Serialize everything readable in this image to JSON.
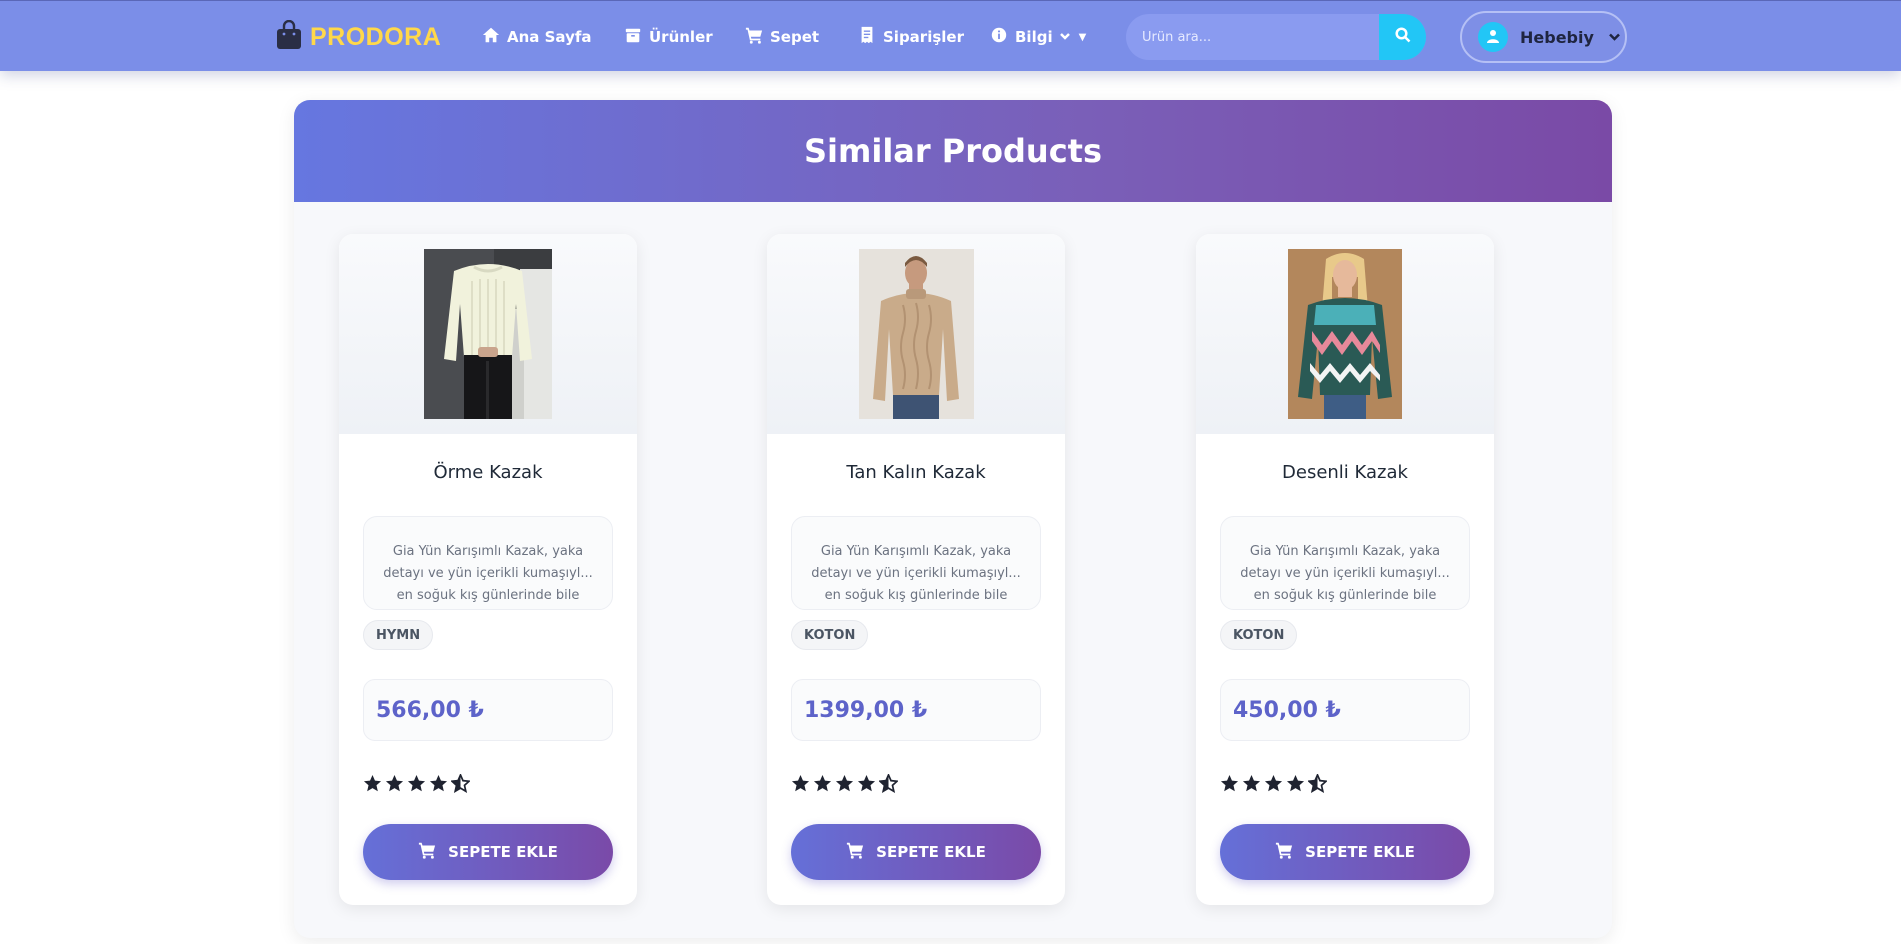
{
  "nav": {
    "brand": "PRODORA",
    "items": [
      {
        "label": "Ana Sayfa",
        "icon": "home-icon"
      },
      {
        "label": "Ürünler",
        "icon": "box-icon"
      },
      {
        "label": "Sepet",
        "icon": "cart-icon"
      },
      {
        "label": "Siparişler",
        "icon": "receipt-icon"
      },
      {
        "label": "Bilgi",
        "icon": "info-icon"
      }
    ],
    "search_placeholder": "Ürün ara...",
    "user_name": "Hebebiy"
  },
  "section": {
    "title": "Similar Products"
  },
  "products": [
    {
      "name": "Örme Kazak",
      "description": "Gia Yün Karışımlı Kazak, yaka detayı ve yün içerikli kumaşıyl... en soğuk kış günlerinde bile",
      "brand": "HYMN",
      "price": "566,00 ₺",
      "rating": 4.5,
      "button_label": "SEPETE EKLE"
    },
    {
      "name": "Tan Kalın Kazak",
      "description": "Gia Yün Karışımlı Kazak, yaka detayı ve yün içerikli kumaşıyl... en soğuk kış günlerinde bile",
      "brand": "KOTON",
      "price": "1399,00 ₺",
      "rating": 4.5,
      "button_label": "SEPETE EKLE"
    },
    {
      "name": "Desenli Kazak",
      "description": "Gia Yün Karışımlı Kazak, yaka detayı ve yün içerikli kumaşıyl... en soğuk kış günlerinde bile",
      "brand": "KOTON",
      "price": "450,00 ₺",
      "rating": 4.5,
      "button_label": "SEPETE EKLE"
    }
  ],
  "colors": {
    "navbar": "#7b8ee8",
    "brand_text": "#ffd84a",
    "search_button": "#22c6f6",
    "price": "#5d63c9",
    "header_gradient_start": "#6677e0",
    "header_gradient_end": "#7a4aa6"
  }
}
